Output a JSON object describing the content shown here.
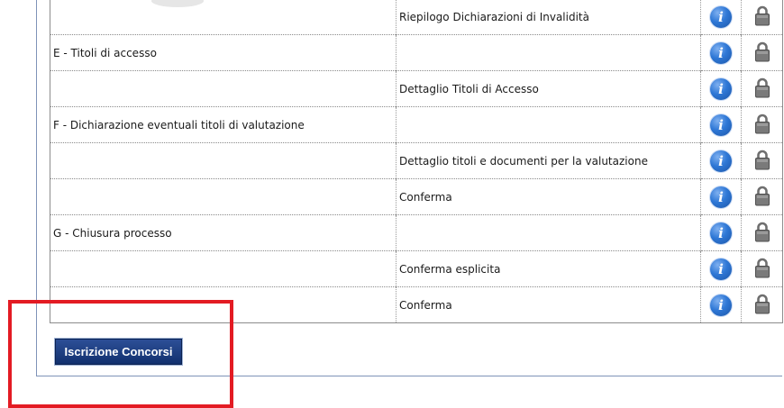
{
  "rows": [
    {
      "section": "",
      "step": "Riepilogo Dichiarazioni di Invalidità"
    },
    {
      "section": "E - Titoli di accesso",
      "step": ""
    },
    {
      "section": "",
      "step": "Dettaglio Titoli di Accesso"
    },
    {
      "section": "F - Dichiarazione eventuali titoli di valutazione",
      "step": ""
    },
    {
      "section": "",
      "step": "Dettaglio titoli e documenti per la valutazione"
    },
    {
      "section": "",
      "step": "Conferma"
    },
    {
      "section": "G - Chiusura processo",
      "step": ""
    },
    {
      "section": "",
      "step": "Conferma esplicita"
    },
    {
      "section": "",
      "step": "Conferma"
    }
  ],
  "icons": {
    "info": "info-icon",
    "lock": "lock-icon",
    "info_glyph": "i"
  },
  "button": {
    "label": "Iscrizione Concorsi"
  },
  "colors": {
    "accent": "#2f78d6",
    "button_bg": "#1e3f86",
    "highlight": "#e31b23"
  }
}
